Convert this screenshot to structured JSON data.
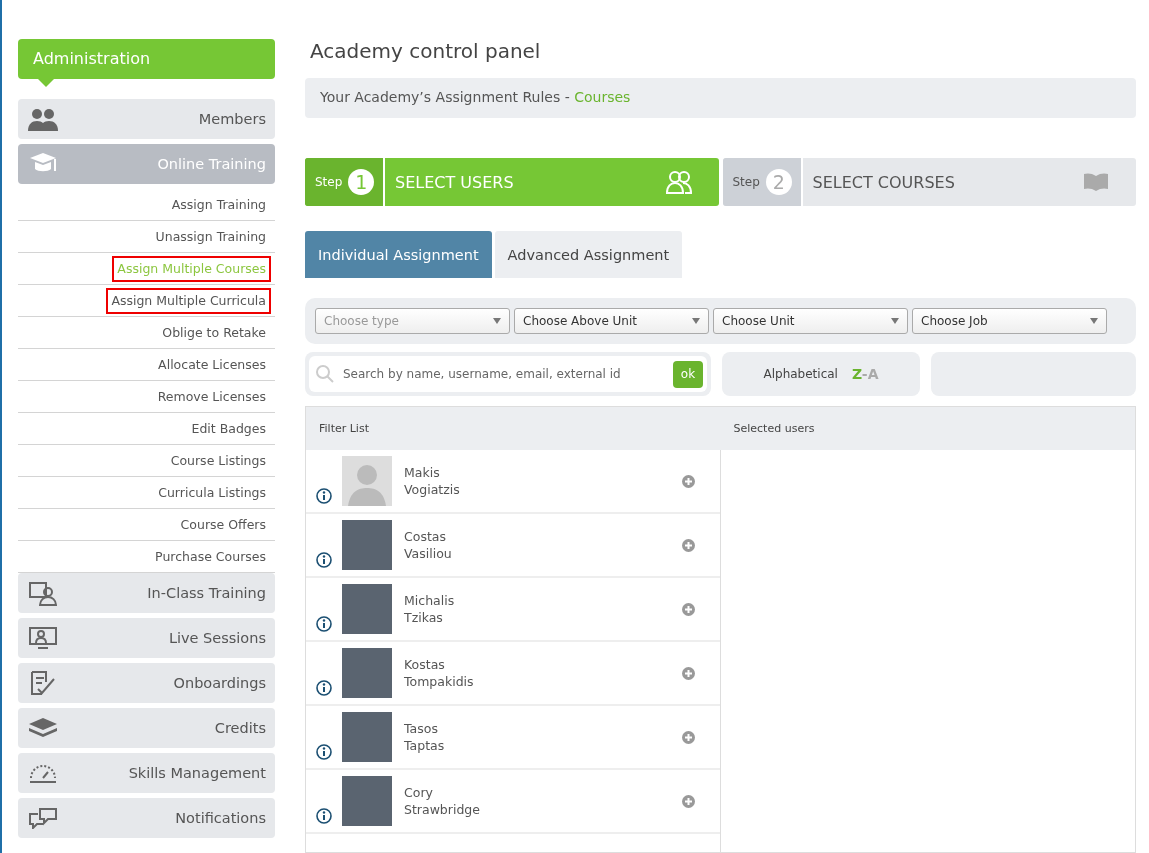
{
  "sidebar": {
    "header": "Administration",
    "sections": [
      {
        "label": "Members",
        "selected": false
      },
      {
        "label": "Online Training",
        "selected": true,
        "children": [
          {
            "label": "Assign Training",
            "selected": false,
            "highlighted": false
          },
          {
            "label": "Unassign Training",
            "selected": false,
            "highlighted": false
          },
          {
            "label": "Assign Multiple Courses",
            "selected": true,
            "highlighted": true
          },
          {
            "label": "Assign Multiple Curricula",
            "selected": false,
            "highlighted": true
          },
          {
            "label": "Oblige to Retake",
            "selected": false,
            "highlighted": false
          },
          {
            "label": "Allocate Licenses",
            "selected": false,
            "highlighted": false
          },
          {
            "label": "Remove Licenses",
            "selected": false,
            "highlighted": false
          },
          {
            "label": "Edit Badges",
            "selected": false,
            "highlighted": false
          },
          {
            "label": "Course Listings",
            "selected": false,
            "highlighted": false
          },
          {
            "label": "Curricula Listings",
            "selected": false,
            "highlighted": false
          },
          {
            "label": "Course Offers",
            "selected": false,
            "highlighted": false
          },
          {
            "label": "Purchase Courses",
            "selected": false,
            "highlighted": false
          }
        ]
      },
      {
        "label": "In-Class Training",
        "selected": false
      },
      {
        "label": "Live Sessions",
        "selected": false
      },
      {
        "label": "Onboardings",
        "selected": false
      },
      {
        "label": "Credits",
        "selected": false
      },
      {
        "label": "Skills Management",
        "selected": false
      },
      {
        "label": "Notifications",
        "selected": false
      }
    ]
  },
  "page_title": "Academy control panel",
  "breadcrumb": {
    "text": "Your Academy’s Assignment Rules - ",
    "link": "Courses"
  },
  "steps": [
    {
      "step_label": "Step",
      "number": "1",
      "title": "SELECT USERS",
      "selected": true
    },
    {
      "step_label": "Step",
      "number": "2",
      "title": "SELECT COURSES",
      "selected": false
    }
  ],
  "tabs": [
    {
      "label": "Individual Assignment",
      "selected": true
    },
    {
      "label": "Advanced Assignment",
      "selected": false
    }
  ],
  "filters": [
    {
      "placeholder": "Choose type"
    },
    {
      "value": "Choose Above Unit"
    },
    {
      "value": "Choose Unit"
    },
    {
      "value": "Choose Job"
    }
  ],
  "search": {
    "placeholder": "Search by name, username, email, external id",
    "button": "ok"
  },
  "sort": {
    "label": "Alphabetical",
    "first": "Z",
    "dash": "-",
    "second": "A"
  },
  "columns": [
    "Filter List",
    "Selected users"
  ],
  "users": [
    {
      "first": "Makis",
      "last": "Vogiatzis",
      "photo": false
    },
    {
      "first": "Costas",
      "last": "Vasiliou",
      "photo": true
    },
    {
      "first": "Michalis",
      "last": "Tzikas",
      "photo": true
    },
    {
      "first": "Kostas",
      "last": "Tompakidis",
      "photo": true
    },
    {
      "first": "Tasos",
      "last": "Taptas",
      "photo": true
    },
    {
      "first": "Cory",
      "last": "Strawbridge",
      "photo": true
    }
  ]
}
